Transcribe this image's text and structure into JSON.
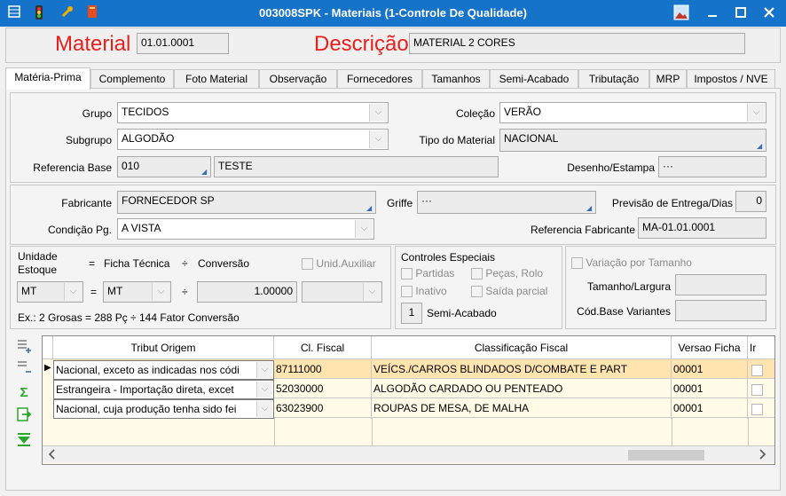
{
  "window": {
    "title": "003008SPK - Materiais (1-Controle De Qualidade)",
    "title_color": "#1573c9"
  },
  "header": {
    "material_label": "Material",
    "material_value": "01.01.0001",
    "descricao_label": "Descrição",
    "descricao_value": "MATERIAL 2 CORES",
    "label_color": "#e8201c"
  },
  "tabs": [
    {
      "label": "Matéria-Prima",
      "active": true
    },
    {
      "label": "Complemento"
    },
    {
      "label": "Foto Material"
    },
    {
      "label": "Observação"
    },
    {
      "label": "Fornecedores"
    },
    {
      "label": "Tamanhos"
    },
    {
      "label": "Semi-Acabado"
    },
    {
      "label": "Tributação"
    },
    {
      "label": "MRP"
    },
    {
      "label": "Impostos / NVE"
    }
  ],
  "section1": {
    "grupo_label": "Grupo",
    "grupo_value": "TECIDOS",
    "colecao_label": "Coleção",
    "colecao_value": "VERÃO",
    "subgrupo_label": "Subgrupo",
    "subgrupo_value": "ALGODÃO",
    "tipo_label": "Tipo do Material",
    "tipo_value": "NACIONAL",
    "ref_base_label": "Referencia Base",
    "ref_base_code": "010",
    "ref_base_desc": "TESTE",
    "desenho_label": "Desenho/Estampa",
    "desenho_value": "···"
  },
  "section2": {
    "fabricante_label": "Fabricante",
    "fabricante_value": "FORNECEDOR SP",
    "griffe_label": "Griffe",
    "griffe_value": "···",
    "previsao_label": "Previsão de Entrega/Dias",
    "previsao_value": "0",
    "cond_label": "Condição Pg.",
    "cond_value": "A VISTA",
    "ref_fab_label": "Referencia Fabricante",
    "ref_fab_value": "MA-01.01.0001"
  },
  "section3": {
    "unidade_label": "Unidade Estoque",
    "eq1": "=",
    "ficha_label": "Ficha Técnica",
    "div1": "÷",
    "conversao_label": "Conversão",
    "unid_aux_label": "Unid.Auxiliar",
    "unid_value": "MT",
    "eq2": "=",
    "ficha_value": "MT",
    "div2": "÷",
    "conversao_value": "1.00000",
    "example": "Ex.:  2 Grosas  = 288 Pç   ÷   144  Fator Conversão",
    "controles_label": "Controles Especiais",
    "partidas_label": "Partidas",
    "pecas_label": "Peças, Rolo",
    "inativo_label": "Inativo",
    "saida_label": "Saída parcial",
    "semi_value": "1",
    "semi_label": "Semi-Acabado",
    "variacao_label": "Variação por Tamanho",
    "tamanho_label": "Tamanho/Largura",
    "cod_base_label": "Cód.Base Variantes"
  },
  "grid": {
    "columns": [
      "Tribut Origem",
      "Cl. Fiscal",
      "Classificação Fiscal",
      "Versao Ficha",
      "Ir"
    ],
    "rows": [
      {
        "origem": "Nacional, exceto as indicadas nos códi",
        "cl_fiscal": "87111000",
        "classificacao": "VEÍCS./CARROS BLINDADOS D/COMBATE E PART",
        "versao": "00001"
      },
      {
        "origem": "Estrangeira - Importação direta, excet",
        "cl_fiscal": "52030000",
        "classificacao": "ALGODÃO CARDADO OU PENTEADO",
        "versao": "00001"
      },
      {
        "origem": "Nacional, cuja produção tenha sido fei",
        "cl_fiscal": "63023900",
        "classificacao": "ROUPAS DE MESA, DE MALHA",
        "versao": "00001"
      }
    ],
    "selected_row_color": "#ffe4b0"
  },
  "icons": {
    "add_row": "add-row-icon",
    "remove_row": "remove-row-icon",
    "sum": "sum-icon",
    "export": "export-icon",
    "filter": "filter-icon"
  }
}
